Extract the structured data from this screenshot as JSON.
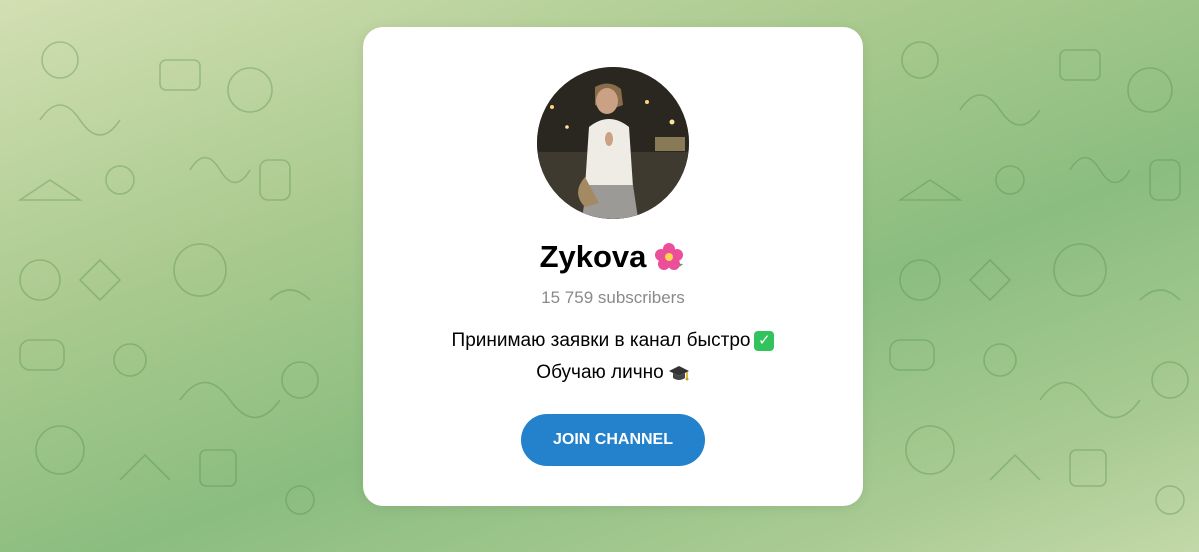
{
  "channel": {
    "name": "Zykova",
    "name_emoji": "flower-icon",
    "subscribers": "15 759 subscribers",
    "description_line1": "Принимаю заявки в канал быстро",
    "description_line1_emoji": "check-mark-icon",
    "description_line2": "Обучаю лично",
    "description_line2_emoji": "graduation-cap-icon"
  },
  "join_button": {
    "label": "JOIN CHANNEL"
  },
  "colors": {
    "accent": "#2481cc",
    "muted_text": "#8a8a8a",
    "check": "#33c35c"
  }
}
